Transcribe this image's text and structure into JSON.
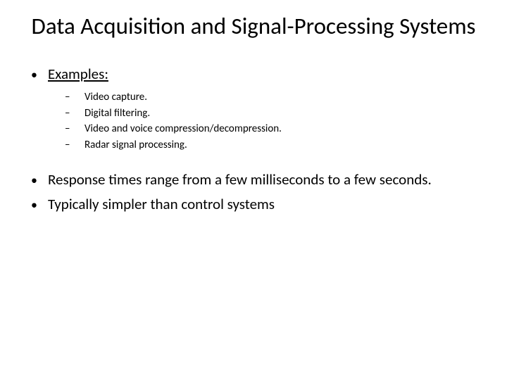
{
  "title": "Data Acquisition and Signal-Processing Systems",
  "examplesLabel": "Examples:",
  "subitems": [
    "Video capture.",
    "Digital filtering.",
    "Video and voice compression/decompression.",
    "Radar signal processing."
  ],
  "bodyBullets": [
    "Response times range from a few milliseconds to a few seconds.",
    "Typically simpler than control systems"
  ]
}
